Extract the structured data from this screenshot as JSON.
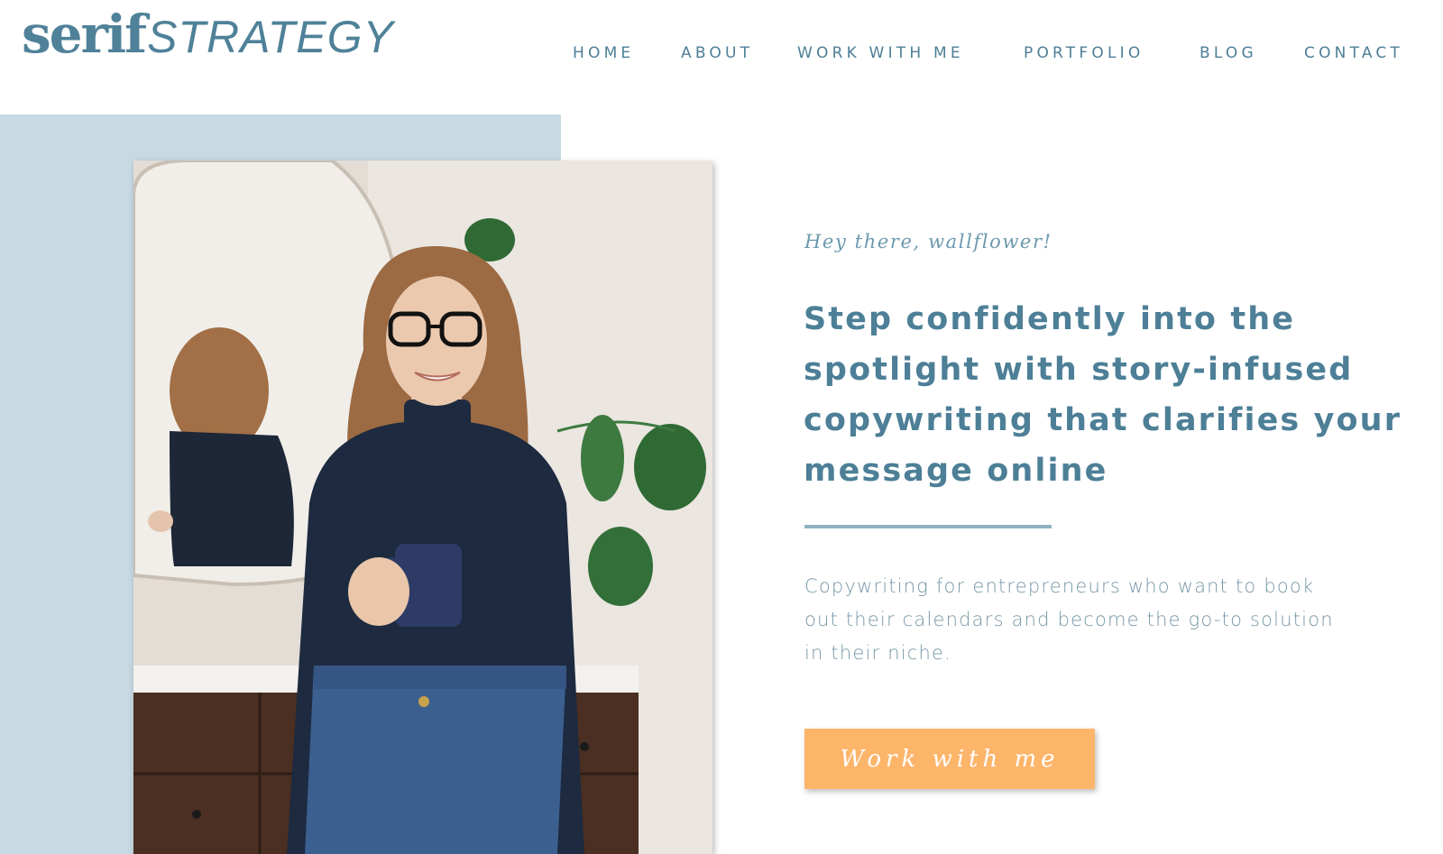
{
  "brand": {
    "logo_part1": "serif",
    "logo_part2": "STRATEGY",
    "color": "#4f8199"
  },
  "nav": {
    "items": [
      "HOME",
      "ABOUT",
      "WORK WITH ME",
      "PORTFOLIO",
      "BLOG",
      "CONTACT"
    ]
  },
  "hero": {
    "greeting": "Hey there, wallflower!",
    "headline_lines": [
      "Step confidently into the",
      "spotlight with story-infused",
      "copywriting that clarifies your",
      "message online"
    ],
    "subtext_lines": [
      "Copywriting for entrepreneurs who want to book",
      "out their calendars and become the go-to solution",
      "in their niche."
    ],
    "cta_label": "Work with me",
    "photo_alt": "Smiling woman with glasses holding a navy mug"
  },
  "colors": {
    "accent_blue": "#4d7f97",
    "panel_blue": "#c7d9e2",
    "divider_blue": "#8eb2c3",
    "cta_orange": "#fdb56a",
    "background": "#ffffff"
  }
}
